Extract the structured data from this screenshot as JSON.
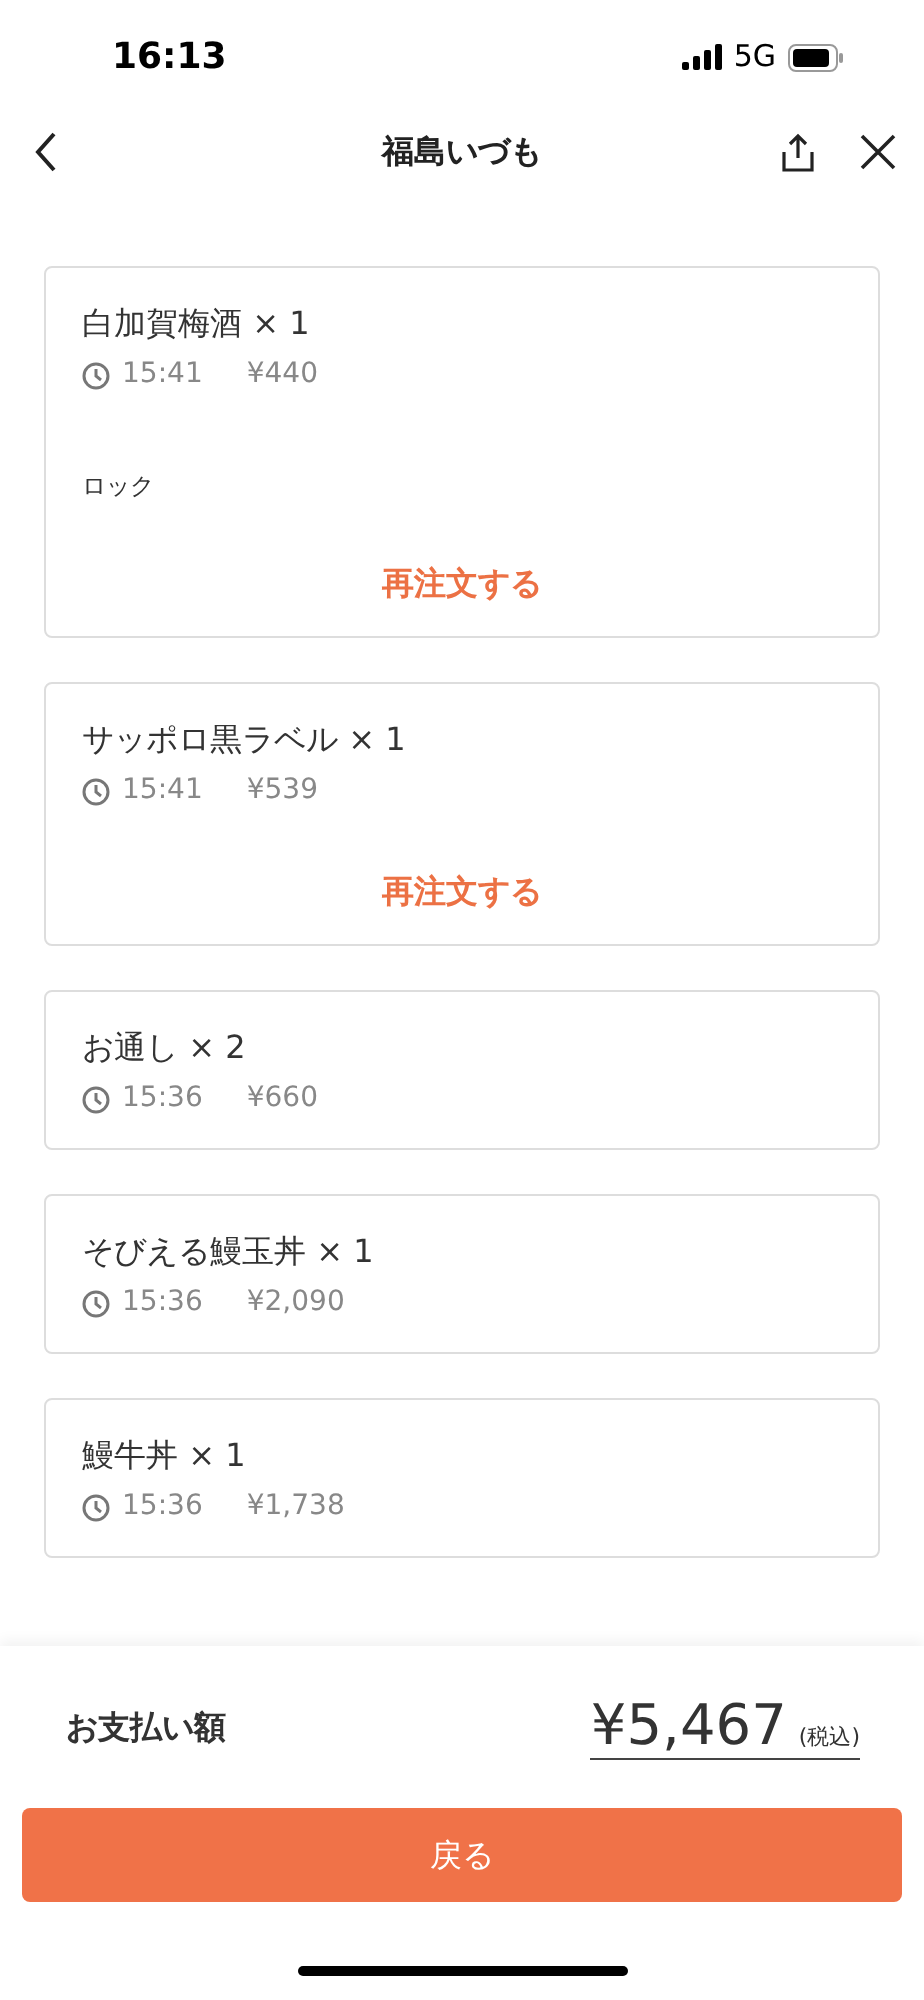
{
  "status_bar": {
    "time": "16:13",
    "network": "5G"
  },
  "header": {
    "title": "福島いづも"
  },
  "orders": [
    {
      "name": "白加賀梅酒 × 1",
      "time": "15:41",
      "price": "¥440",
      "note": "ロック",
      "reorder": "再注文する"
    },
    {
      "name": "サッポロ黒ラベル × 1",
      "time": "15:41",
      "price": "¥539",
      "reorder": "再注文する"
    },
    {
      "name": "お通し × 2",
      "time": "15:36",
      "price": "¥660"
    },
    {
      "name": "そびえる鰻玉丼 × 1",
      "time": "15:36",
      "price": "¥2,090"
    },
    {
      "name": "鰻牛丼 × 1",
      "time": "15:36",
      "price": "¥1,738"
    }
  ],
  "total": {
    "label": "お支払い額",
    "amount": "¥5,467",
    "tax_note": "(税込)"
  },
  "back_button": "戻る"
}
